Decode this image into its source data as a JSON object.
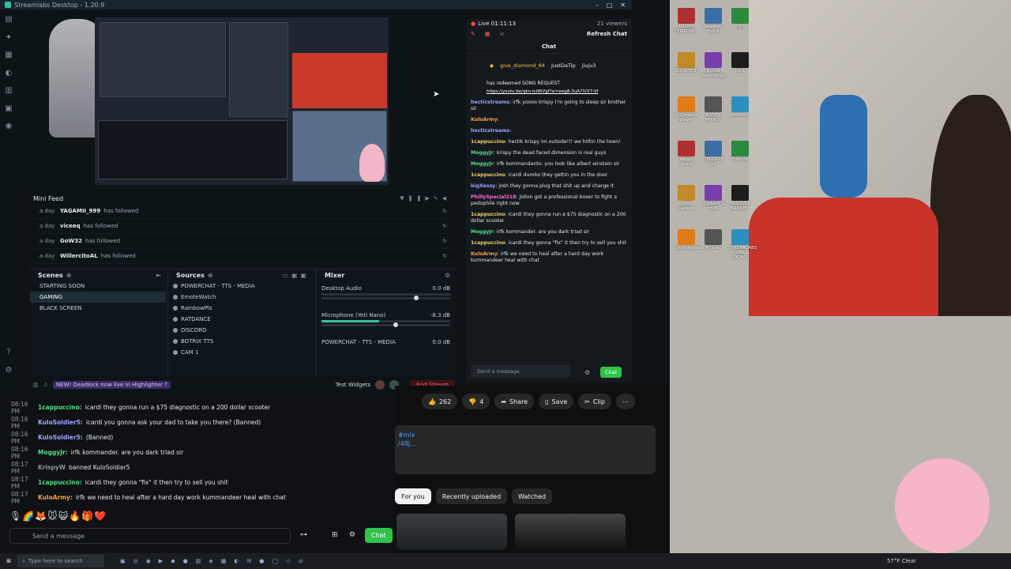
{
  "app": {
    "title": "Streamlabs Desktop - 1.20.9"
  },
  "window_controls": [
    "–",
    "□",
    "✕"
  ],
  "mini_feed": {
    "title": "Mini Feed",
    "rows": [
      {
        "age": "a day",
        "name": "YAGAMII_999",
        "action": "has followed"
      },
      {
        "age": "a day",
        "name": "viceeq",
        "action": "has followed"
      },
      {
        "age": "a day",
        "name": "GoW32",
        "action": "has followed"
      },
      {
        "age": "a day",
        "name": "WillercitoAL",
        "action": "has followed"
      }
    ]
  },
  "scenes": {
    "title": "Scenes",
    "items": [
      {
        "label": "STARTING SOON"
      },
      {
        "label": "GAMING"
      },
      {
        "label": "BLACK SCREEN"
      }
    ],
    "selected": "GAMING"
  },
  "sources": {
    "title": "Sources",
    "items": [
      {
        "label": "POWERCHAT - TTS - MEDIA"
      },
      {
        "label": "EmoteWatch"
      },
      {
        "label": "RainbowPls"
      },
      {
        "label": "RATDANCE"
      },
      {
        "label": "DISCORD"
      },
      {
        "label": "BOTRIX TTS"
      },
      {
        "label": "CAM 1"
      }
    ]
  },
  "mixer": {
    "title": "Mixer",
    "channels": [
      {
        "name": "Desktop Audio",
        "db": "0.0 dB",
        "level": 0.0
      },
      {
        "name": "Microphone (Yeti Nano)",
        "db": "-8.3 dB",
        "level": 0.45
      },
      {
        "name": "POWERCHAT - TTS - MEDIA",
        "db": "0.0 dB",
        "level": 0.0
      }
    ]
  },
  "statusbar": {
    "notice": "NEW! Deadlock now live in Highlighter ?",
    "test_widgets": "Test Widgets",
    "end_stream": "End Stream"
  },
  "sl_chat": {
    "live": "Live 01:11:13",
    "viewers": "21 viewers",
    "refresh": "Refresh Chat",
    "title": "Chat",
    "top_users": [
      {
        "name": "give_diamond_84",
        "count": "3"
      },
      {
        "name": "JustDaTip",
        "count": "2"
      },
      {
        "name": "jiuju3",
        "count": "1"
      }
    ],
    "redeem": "has redeemed SONG REQUEST",
    "link": "https://youtu.be/qkn-lct8tVgf?si=eeg8-3uA7lVX7-Vf",
    "messages": [
      {
        "user": "hecticstreams",
        "text": "irfk yoooo krispy I'm going to sleep sir brother sir",
        "color": "u"
      },
      {
        "user": "KuloArmy",
        "text": "",
        "color": "o"
      },
      {
        "user": "hecticstreams",
        "text": "",
        "color": "u"
      },
      {
        "user": "1cappuccino",
        "text": "hectik krispy im outside!!! we hittin the town!",
        "color": "y"
      },
      {
        "user": "MoggyJr",
        "text": "krispy the dead faced dimension is real guys",
        "color": "g"
      },
      {
        "user": "MoggyJr",
        "text": "irfk kommandanto. you look like albert einstein sir",
        "color": "g"
      },
      {
        "user": "1cappuccino",
        "text": "icardi dumbo they gettin you in the door",
        "color": "y"
      },
      {
        "user": "bigXessy",
        "text": "josh they gonna plug that shit up and charge it",
        "color": "u"
      },
      {
        "user": "PhillySpecial218",
        "text": "Jidion got a professional boxer to fight a pedophile right now",
        "color": "p"
      },
      {
        "user": "1cappuccino",
        "text": "icardi they gonna run a $75 diagnostic on a 200 dollar scooter",
        "color": "y"
      },
      {
        "user": "MoggyJr",
        "text": "irfk kommander. are you dark triad sir",
        "color": "g"
      },
      {
        "user": "1cappuccino",
        "text": "icardi they gonna \"fix\" it then try to sell you shit",
        "color": "y"
      },
      {
        "user": "KuloArmy",
        "text": "irfk we need to heal after a hard day work kummandeer heal with chat",
        "color": "o"
      }
    ],
    "placeholder": "Send a message",
    "chat_btn": "Chat"
  },
  "yt_chat": {
    "lines": [
      {
        "time": "08:16 PM",
        "user": "1cappuccino:",
        "color": "#4fdf8a",
        "text": "icardi they gonna run a $75 diagnostic on a 200 dollar scooter"
      },
      {
        "time": "08:16 PM",
        "user": "KuloSoldier5:",
        "color": "#9aa5ff",
        "text": "icardi you gonna ask your dad to take you there? (Banned)"
      },
      {
        "time": "08:16 PM",
        "user": "KuloSoldier5:",
        "color": "#9aa5ff",
        "text": "(Banned)"
      },
      {
        "time": "08:16 PM",
        "user": "MoggyJr:",
        "color": "#4fdf8a",
        "text": "irfk kommander. are you dark triad sir"
      },
      {
        "time": "08:17 PM",
        "user": "KrispyW",
        "color": "#8f969c",
        "text": "banned KuloSoldier5"
      },
      {
        "time": "08:17 PM",
        "user": "1cappuccino:",
        "color": "#4fdf8a",
        "text": "icardi they gonna \"fix\" it then try to sell you shit"
      },
      {
        "time": "08:17 PM",
        "user": "KuloArmy:",
        "color": "#f9a045",
        "text": "irfk we need to heal after a hard day work kummandeer heal with chat"
      }
    ],
    "placeholder": "Send a message",
    "chat_btn": "Chat"
  },
  "youtube": {
    "likes": "262",
    "dislikes": "4",
    "share": "Share",
    "save": "Save",
    "clip": "Clip",
    "hashtag": "#mlx",
    "link_frag": "/48J...",
    "tabs": [
      "For you",
      "Recently uploaded",
      "Watched"
    ]
  },
  "desktop_icons": [
    "KRISPY CHRISTM...",
    "Resident Evil 4",
    "PICS",
    "GOONTENT",
    "Nvidia Recordings",
    "KICK",
    "VLC media player",
    "BOOTY PATROL",
    "ADIDAS",
    "happy ghast",
    "DELL XPS 13",
    "Fortnite",
    "Little Caesars",
    "Logitech G HUB",
    "YOUTUBE BANNE...",
    "cyberiachest",
    "MINI PC",
    "STREAMLABS OBS LOGIN..."
  ],
  "taskbar": {
    "search_placeholder": "Type here to search",
    "weather": "57°F Clear"
  },
  "colors": {
    "accent": "#31c3a2",
    "chat_green": "#2ec44a",
    "end_stream": "#ff5564"
  }
}
